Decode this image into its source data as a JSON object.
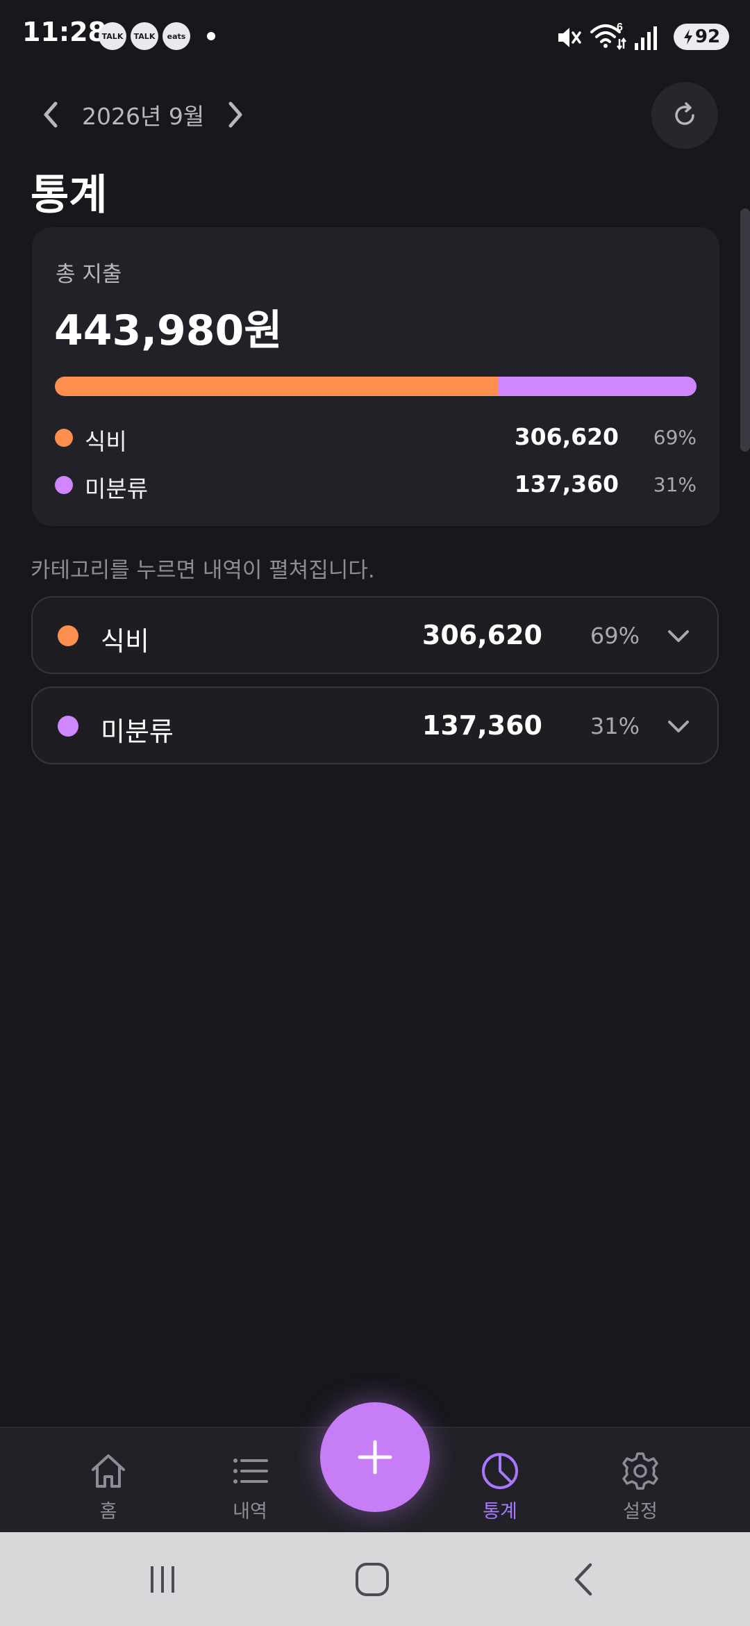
{
  "status_bar": {
    "time": "11:28",
    "app_icons": [
      "TALK",
      "TALK",
      "eats"
    ],
    "battery": "92",
    "network_badge": "6"
  },
  "header": {
    "month": "2026년 9월",
    "title": "통계"
  },
  "summary": {
    "label": "총 지출",
    "total": "443,980원",
    "segments": [
      {
        "name": "식비",
        "amount": "306,620",
        "percent": "69%",
        "share": 0.69,
        "color": "#ff8f4f"
      },
      {
        "name": "미분류",
        "amount": "137,360",
        "percent": "31%",
        "share": 0.31,
        "color": "#cf86ff"
      }
    ]
  },
  "hint": "카테고리를 누르면 내역이 펼쳐집니다.",
  "categories": [
    {
      "name": "식비",
      "amount": "306,620",
      "percent": "69%",
      "color": "#ff8f4f"
    },
    {
      "name": "미분류",
      "amount": "137,360",
      "percent": "31%",
      "color": "#cf86ff"
    }
  ],
  "tabs": [
    {
      "label": "홈",
      "icon": "home-icon"
    },
    {
      "label": "내역",
      "icon": "list-icon"
    },
    {
      "label": "통계",
      "icon": "pie-chart-icon",
      "active": true
    },
    {
      "label": "설정",
      "icon": "gear-icon"
    }
  ],
  "colors": {
    "accent": "#c77df6",
    "active_tab": "#a978ff",
    "background": "#17171c"
  }
}
